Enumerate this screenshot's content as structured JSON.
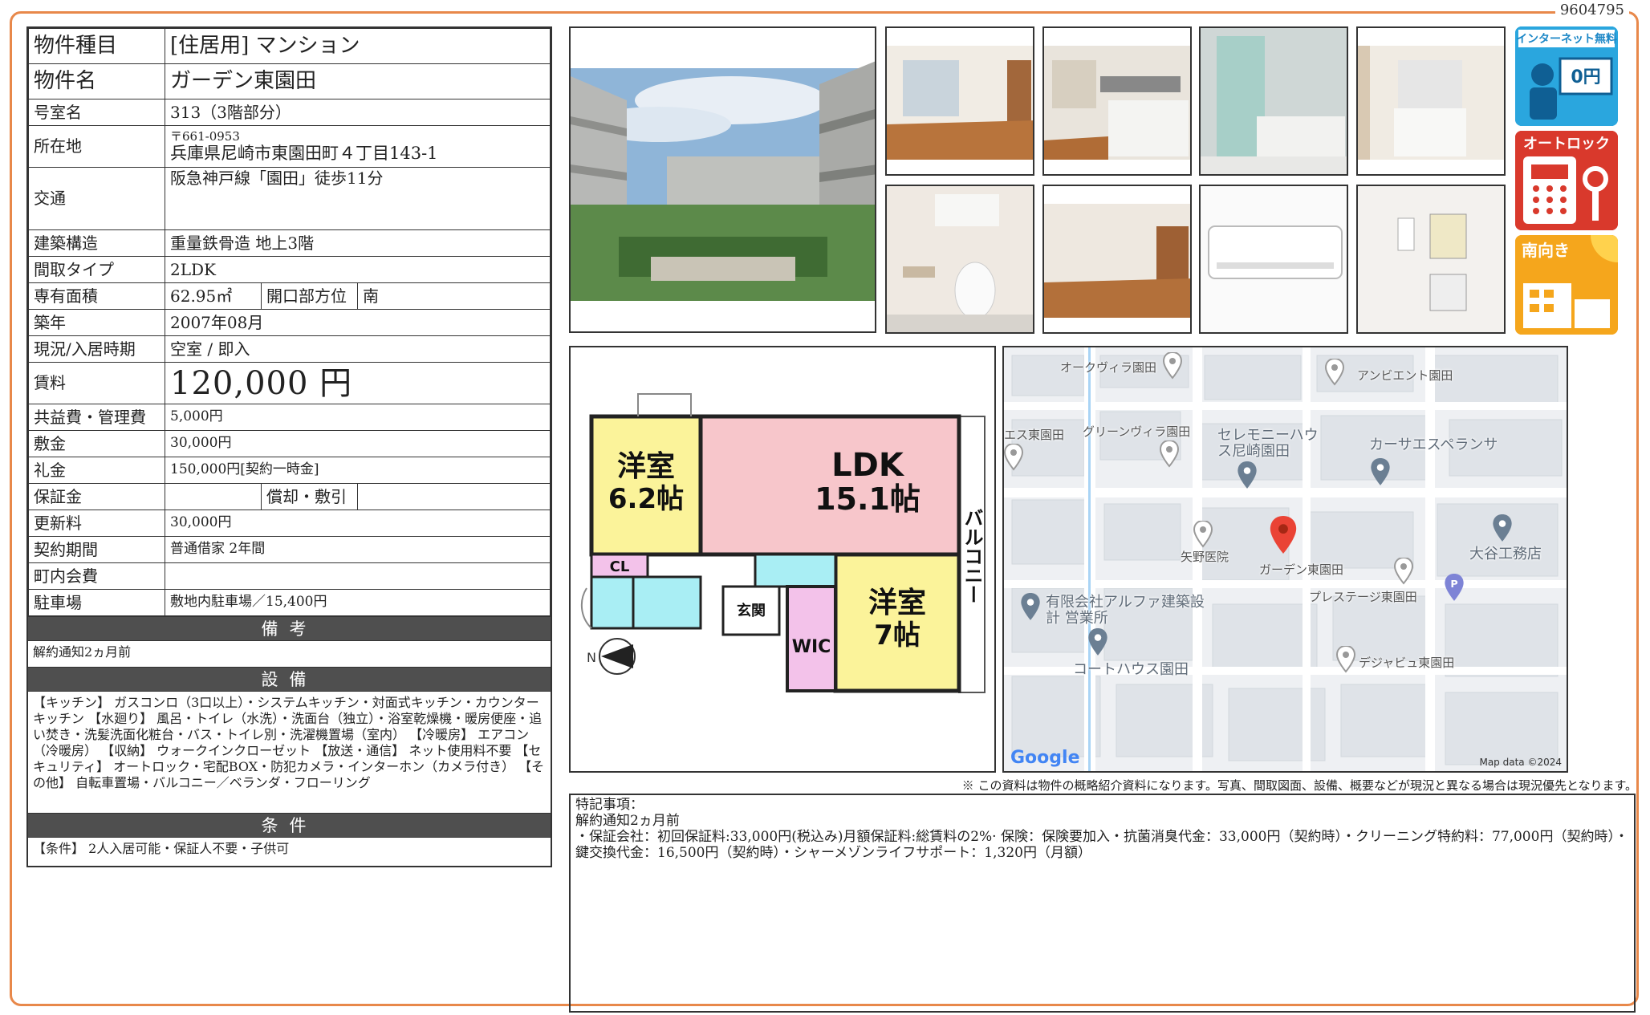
{
  "property_id": "9604795",
  "info": {
    "type_label": "物件種目",
    "type_value": "[住居用] マンション",
    "name_label": "物件名",
    "name_value": "ガーデン東園田",
    "room_label": "号室名",
    "room_value": "313（3階部分）",
    "address_label": "所在地",
    "zip": "〒661-0953",
    "address": "兵庫県尼崎市東園田町４丁目143-1",
    "traffic_label": "交通",
    "traffic_value": "阪急神戸線「園田」徒歩11分",
    "structure_label": "建築構造",
    "structure_value": "重量鉄骨造 地上3階",
    "layout_label": "間取タイプ",
    "layout_value": "2LDK",
    "area_label": "専有面積",
    "area_value": "62.95㎡",
    "direction_label": "開口部方位",
    "direction_value": "南",
    "built_label": "築年",
    "built_value": "2007年08月",
    "status_label": "現況/入居時期",
    "status_value": "空室 / 即入",
    "rent_label": "賃料",
    "rent_value": "120,000 円",
    "fee_label": "共益費・管理費",
    "fee_value": "5,000円",
    "deposit_label": "敷金",
    "deposit_value": "30,000円",
    "keymoney_label": "礼金",
    "keymoney_value": "150,000円[契約一時金]",
    "guarantee_label": "保証金",
    "guarantee_value": "",
    "amort_label": "償却・敷引",
    "amort_value": "",
    "renewal_label": "更新料",
    "renewal_value": "30,000円",
    "contract_label": "契約期間",
    "contract_value": "普通借家 2年間",
    "town_label": "町内会費",
    "town_value": "",
    "parking_label": "駐車場",
    "parking_value": "敷地内駐車場／15,400円"
  },
  "sections": {
    "notes_title": "備考",
    "notes_text": "解約通知2ヵ月前",
    "equip_title": "設備",
    "equip_text": "【キッチン】 ガスコンロ（3口以上）・システムキッチン・対面式キッチン・カウンターキッチン 【水廻り】 風呂・トイレ（水洗）・洗面台（独立）・浴室乾燥機・暖房便座・追い焚き・洗髪洗面化粧台・バス・トイレ別・洗濯機置場（室内） 【冷暖房】 エアコン（冷暖房） 【収納】 ウォークインクローゼット 【放送・通信】 ネット使用料不要 【セキュリティ】 オートロック・宅配BOX・防犯カメラ・インターホン（カメラ付き） 【その他】 自転車置場・バルコニー／ベランダ・フローリング",
    "cond_title": "条件",
    "cond_text": "【条件】 2人入居可能・保証人不要・子供可"
  },
  "badges": {
    "internet_title": "インターネット無料",
    "internet_price": "0円",
    "autolock_title": "オートロック",
    "south_title": "南向き"
  },
  "floorplan": {
    "room1": "洋室",
    "room1_size": "6.2帖",
    "ldk": "LDK",
    "ldk_size": "15.1帖",
    "room2": "洋室",
    "room2_size": "7帖",
    "balcony": "バルコニー",
    "cl": "CL",
    "entrance": "玄関",
    "wic": "WIC",
    "north": "N"
  },
  "map": {
    "labels": [
      "オークヴィラ園田",
      "アンビエント園田",
      "エス東園田",
      "グリーンヴィラ園田",
      "セレモニーハウス尼崎園田",
      "カーサエスペランサ",
      "矢野医院",
      "ガーデン東園田",
      "大谷工務店",
      "プレステージ東園田",
      "有限会社アルファ建築設計 営業所",
      "コートハウス園田",
      "デジャビュ東園田"
    ],
    "google": "Google",
    "mapdata": "Map data ©2024"
  },
  "disclaimer": "※ この資料は物件の概略紹介資料になります。写真、間取図面、設備、概要などが現況と異なる場合は現況優先となります。",
  "remarks": {
    "title": "特記事項：",
    "line1": "解約通知2ヵ月前",
    "line2": "・保証会社：初回保証料:33,000円(税込み)月額保証料:総賃料の2%· 保険：保険要加入・抗菌消臭代金：33,000円（契約時）・クリーニング特約料：77,000円（契約時）・鍵交換代金：16,500円（契約時）・シャーメゾンライフサポート：1,320円（月額）"
  }
}
